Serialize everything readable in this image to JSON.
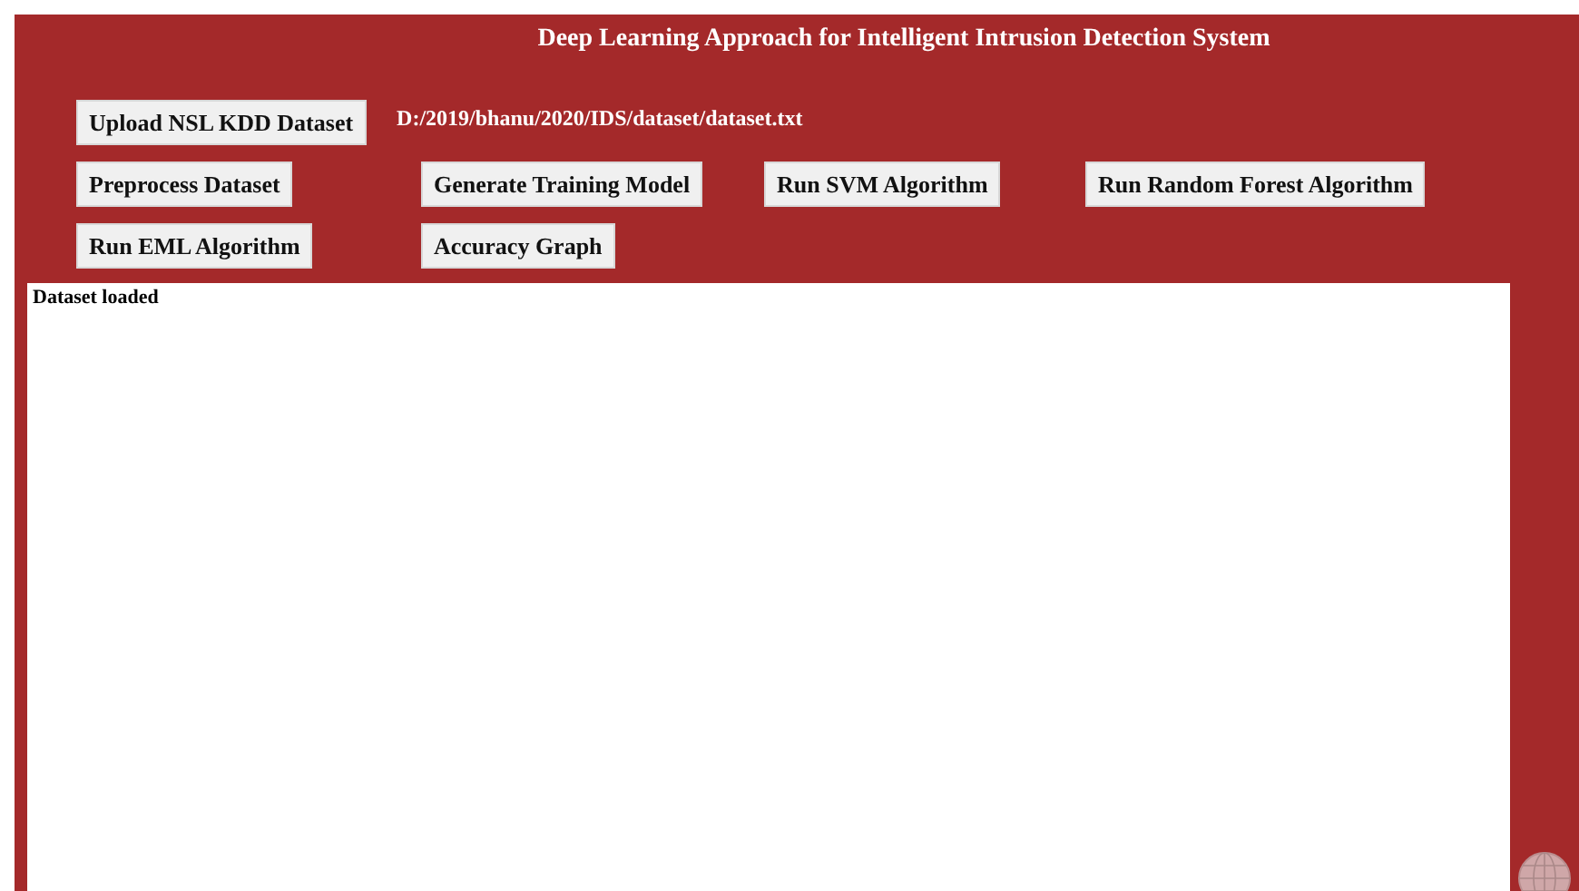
{
  "window": {
    "title": "Deep Learning Approach for Intelligent Intrusion Detection System"
  },
  "upload_button": {
    "label": "Upload NSL KDD Dataset"
  },
  "dataset_path": "D:/2019/bhanu/2020/IDS/dataset/dataset.txt",
  "buttons": [
    {
      "label": "Preprocess Dataset"
    },
    {
      "label": "Generate Training Model"
    },
    {
      "label": "Run SVM Algorithm"
    },
    {
      "label": "Run Random Forest Algorithm"
    },
    {
      "label": "Run EML Algorithm"
    },
    {
      "label": "Accuracy Graph"
    }
  ],
  "output": {
    "text": "Dataset loaded"
  }
}
